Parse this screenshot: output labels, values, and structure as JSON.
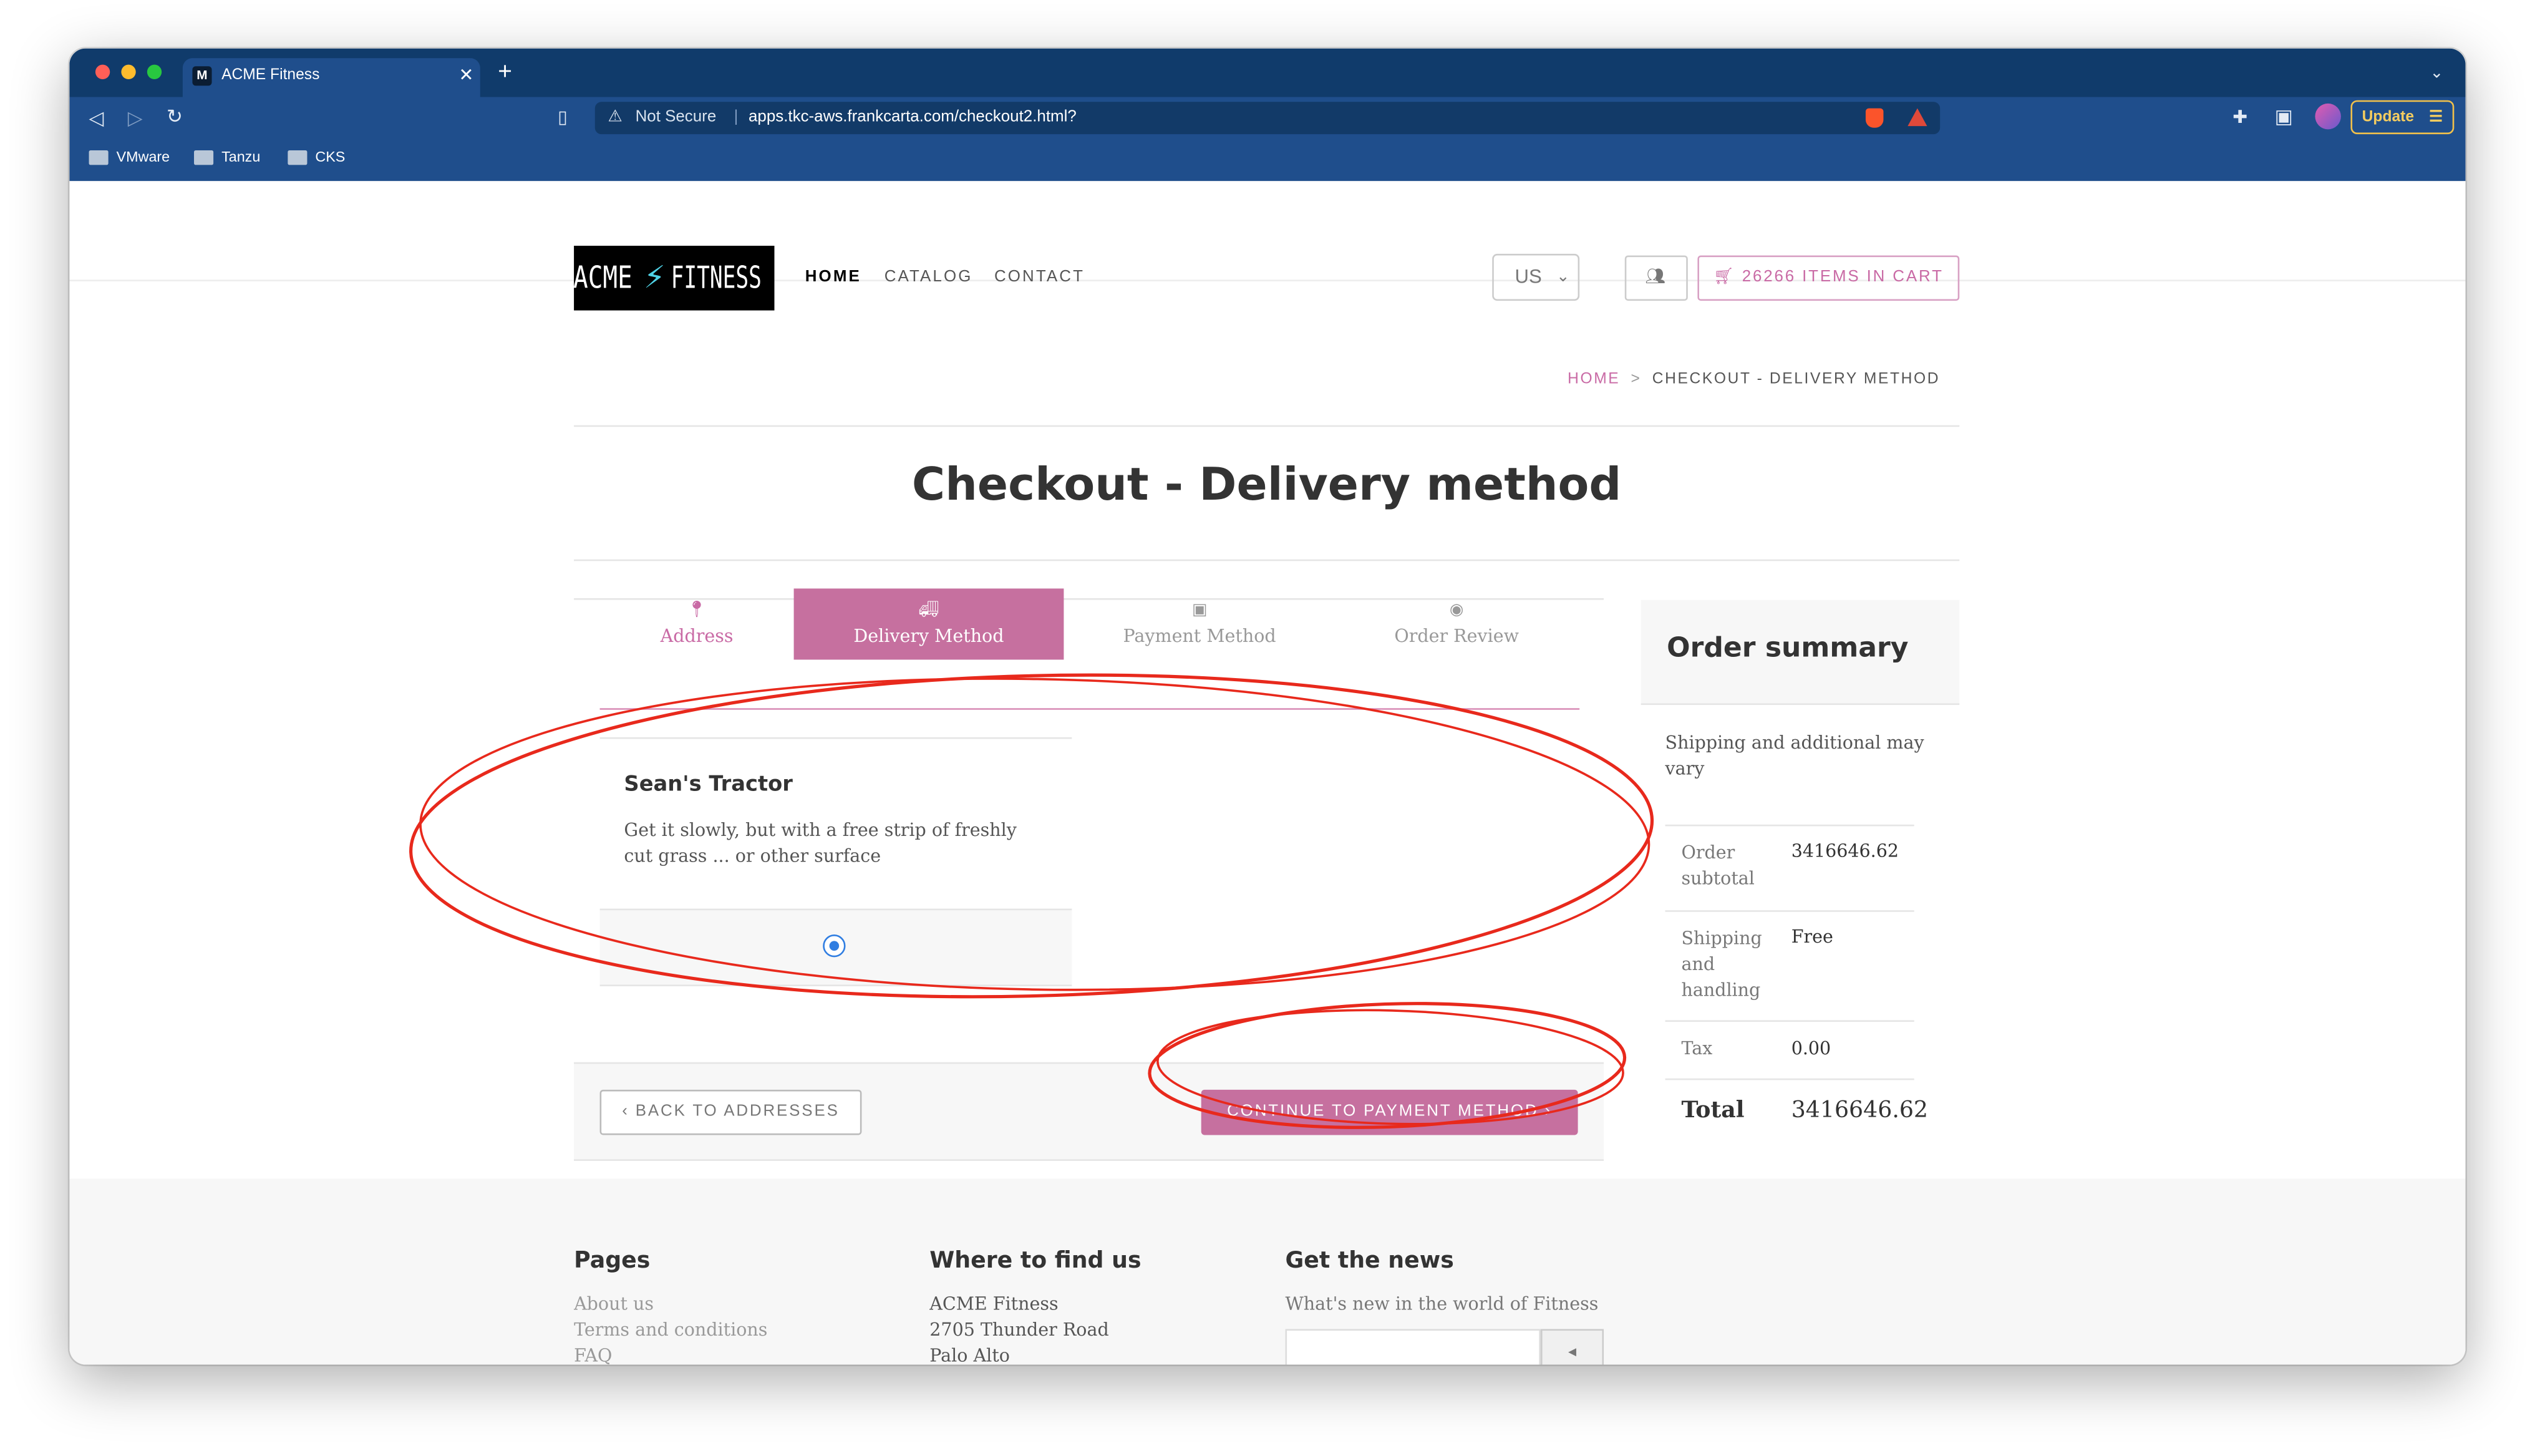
{
  "browser": {
    "tab_title": "ACME Fitness",
    "tab_favicon_letter": "M",
    "security_label": "Not Secure",
    "url": "apps.tkc-aws.frankcarta.com/checkout2.html?",
    "update_label": "Update",
    "bookmarks": [
      "VMware",
      "Tanzu",
      "CKS"
    ],
    "colors": {
      "tabstrip": "#103b6b",
      "toolbar": "#1f4e8c"
    }
  },
  "header": {
    "logo_left": "ACME",
    "logo_right": "FITNESS",
    "nav": [
      "HOME",
      "CATALOG",
      "CONTACT"
    ],
    "country_select": "US",
    "cart_label": "26266 ITEMS IN CART"
  },
  "breadcrumb": {
    "home": "HOME",
    "separator": ">",
    "current": "CHECKOUT - DELIVERY METHOD"
  },
  "page_title": "Checkout - Delivery method",
  "steps": [
    {
      "label": "Address",
      "icon": "map-marker-icon",
      "state": "done"
    },
    {
      "label": "Delivery Method",
      "icon": "truck-icon",
      "state": "active"
    },
    {
      "label": "Payment Method",
      "icon": "money-icon",
      "state": "disabled"
    },
    {
      "label": "Order Review",
      "icon": "eye-icon",
      "state": "disabled"
    }
  ],
  "delivery_option": {
    "name": "Sean's Tractor",
    "description": "Get it slowly, but with a free strip of freshly cut grass ... or other surface",
    "selected": true
  },
  "actions": {
    "back": "BACK TO ADDRESSES",
    "continue": "CONTINUE TO PAYMENT METHOD"
  },
  "order_summary": {
    "title": "Order summary",
    "note": "Shipping and additional may vary",
    "rows": [
      {
        "label": "Order subtotal",
        "value": "3416646.62"
      },
      {
        "label": "Shipping and handling",
        "value": "Free"
      },
      {
        "label": "Tax",
        "value": "0.00"
      }
    ],
    "total_label": "Total",
    "total_value": "3416646.62"
  },
  "footer": {
    "pages_title": "Pages",
    "pages_links": [
      "About us",
      "Terms and conditions",
      "FAQ"
    ],
    "find_title": "Where to find us",
    "address_lines": [
      "ACME Fitness",
      "2705 Thunder Road",
      "Palo Alto"
    ],
    "news_title": "Get the news",
    "news_text": "What's new in the world of Fitness"
  },
  "accent_color": "#c96aa5",
  "annotation_color": "#e8291c"
}
